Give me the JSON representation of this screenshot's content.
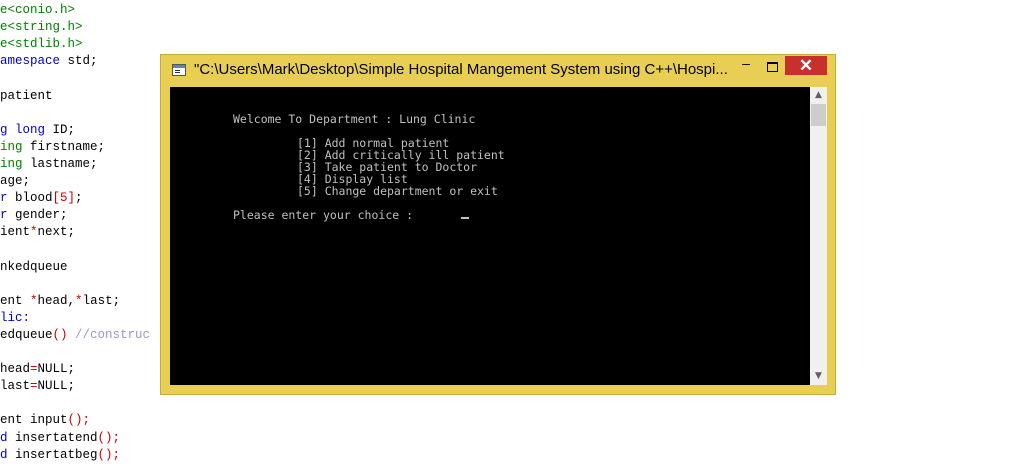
{
  "editor": {
    "lines": [
      {
        "parts": [
          {
            "t": "e",
            "c": "inc"
          },
          {
            "t": "<conio.h>",
            "c": "inc"
          }
        ]
      },
      {
        "parts": [
          {
            "t": "e<string.h>",
            "c": "inc"
          }
        ]
      },
      {
        "parts": [
          {
            "t": "e<stdlib.h>",
            "c": "inc"
          }
        ]
      },
      {
        "parts": [
          {
            "t": "amespace ",
            "c": "kw"
          },
          {
            "t": "std;",
            "c": ""
          }
        ]
      },
      {
        "parts": []
      },
      {
        "parts": [
          {
            "t": "patient",
            "c": ""
          }
        ]
      },
      {
        "parts": []
      },
      {
        "parts": [
          {
            "t": "g long ",
            "c": "kw"
          },
          {
            "t": "ID;",
            "c": ""
          }
        ]
      },
      {
        "parts": [
          {
            "t": "ing ",
            "c": "ty"
          },
          {
            "t": "firstname;",
            "c": ""
          }
        ]
      },
      {
        "parts": [
          {
            "t": "ing ",
            "c": "ty"
          },
          {
            "t": "lastname;",
            "c": ""
          }
        ]
      },
      {
        "parts": [
          {
            "t": "age;",
            "c": ""
          }
        ]
      },
      {
        "parts": [
          {
            "t": "r ",
            "c": "kw"
          },
          {
            "t": "blood",
            "c": ""
          },
          {
            "t": "[5]",
            "c": "num"
          },
          {
            "t": ";",
            "c": ""
          }
        ]
      },
      {
        "parts": [
          {
            "t": "r ",
            "c": "kw"
          },
          {
            "t": "gender;",
            "c": ""
          }
        ]
      },
      {
        "parts": [
          {
            "t": "ient",
            "c": ""
          },
          {
            "t": "*",
            "c": "op"
          },
          {
            "t": "next;",
            "c": ""
          }
        ]
      },
      {
        "parts": []
      },
      {
        "parts": [
          {
            "t": "nkedqueue",
            "c": ""
          }
        ]
      },
      {
        "parts": []
      },
      {
        "parts": [
          {
            "t": "ent ",
            "c": ""
          },
          {
            "t": "*",
            "c": "op"
          },
          {
            "t": "head,",
            "c": ""
          },
          {
            "t": "*",
            "c": "op"
          },
          {
            "t": "last;",
            "c": ""
          }
        ]
      },
      {
        "parts": [
          {
            "t": "lic:",
            "c": "kw"
          }
        ]
      },
      {
        "parts": [
          {
            "t": "edqueue",
            "c": ""
          },
          {
            "t": "() ",
            "c": "op"
          },
          {
            "t": "//construc",
            "c": "cm"
          }
        ]
      },
      {
        "parts": []
      },
      {
        "parts": [
          {
            "t": "head",
            "c": ""
          },
          {
            "t": "=",
            "c": "op"
          },
          {
            "t": "NULL;",
            "c": ""
          }
        ]
      },
      {
        "parts": [
          {
            "t": "last",
            "c": ""
          },
          {
            "t": "=",
            "c": "op"
          },
          {
            "t": "NULL;",
            "c": ""
          }
        ]
      },
      {
        "parts": []
      },
      {
        "parts": [
          {
            "t": "ent input",
            "c": ""
          },
          {
            "t": "();",
            "c": "op"
          }
        ]
      },
      {
        "parts": [
          {
            "t": "d ",
            "c": "kw"
          },
          {
            "t": "insertatend",
            "c": ""
          },
          {
            "t": "();",
            "c": "op"
          }
        ]
      },
      {
        "parts": [
          {
            "t": "d ",
            "c": "kw"
          },
          {
            "t": "insertatbeg",
            "c": ""
          },
          {
            "t": "();",
            "c": "op"
          }
        ]
      }
    ]
  },
  "window": {
    "title": "\"C:\\Users\\Mark\\Desktop\\Simple Hospital Mangement System using C++\\Hospi...",
    "min_label": "‒",
    "close_label": "✕"
  },
  "console": {
    "welcome": "Welcome To Department : Lung Clinic",
    "menu": [
      "[1] Add normal patient",
      "[2] Add critically ill patient",
      "[3] Take patient to Doctor",
      "[4] Display list",
      "[5] Change department or exit"
    ],
    "prompt": "Please enter your choice : "
  },
  "scrollbar": {
    "up_arrow": "▲",
    "down_arrow": "▼"
  }
}
